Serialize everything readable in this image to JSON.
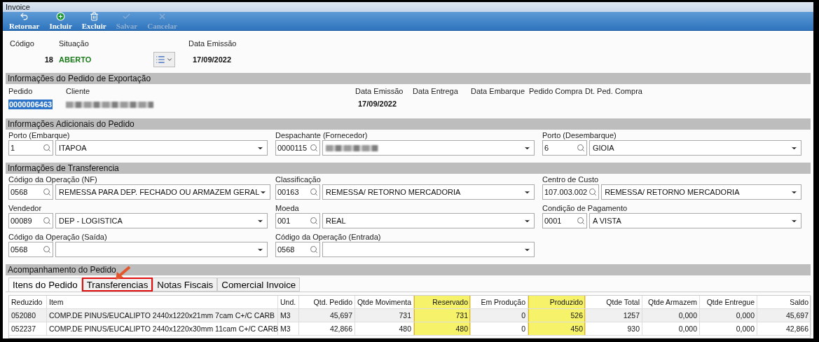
{
  "window": {
    "title": "Invoice"
  },
  "toolbar": [
    {
      "label": "Retornar",
      "disabled": false
    },
    {
      "label": "Incluir",
      "disabled": false
    },
    {
      "label": "Excluir",
      "disabled": false
    },
    {
      "label": "Salvar",
      "disabled": true
    },
    {
      "label": "Cancelar",
      "disabled": true
    }
  ],
  "header": {
    "codigo": {
      "label": "Código",
      "value": "18"
    },
    "situacao": {
      "label": "Situação",
      "value": "ABERTO"
    },
    "data_emissao": {
      "label": "Data Emissão",
      "value": "17/09/2022"
    }
  },
  "export_section": {
    "title": "Informações do Pedido de Exportação",
    "fields": [
      {
        "label": "Pedido",
        "value": "0000006463",
        "selected": true
      },
      {
        "label": "Cliente",
        "redacted": true
      }
    ],
    "dates": [
      {
        "label": "Data Emissão",
        "value": "17/09/2022"
      },
      {
        "label": "Data Entrega"
      },
      {
        "label": "Data Embarque"
      },
      {
        "label": "Pedido Compra"
      },
      {
        "label": "Dt. Ped. Compra"
      }
    ]
  },
  "sections": [
    {
      "title": "Informações Adicionais do Pedido",
      "rows": [
        [
          {
            "label": "Porto (Embarque)",
            "code": "1",
            "value": "ITAPOA"
          },
          {
            "label": "Despachante (Fornecedor)",
            "code": "0000115",
            "value_redacted": true
          },
          {
            "label": "Porto (Desembarque)",
            "code": "6",
            "value": "GIOIA"
          }
        ]
      ]
    },
    {
      "title": "Informações de Transferencia",
      "rows": [
        [
          {
            "label": "Código da Operação (NF)",
            "code": "0568",
            "value": "REMESSA PARA DEP. FECHADO OU ARMAZEM GERAL"
          },
          {
            "label": "Classificação",
            "code": "00163",
            "value": "REMESSA/ RETORNO MERCADORIA"
          },
          {
            "label": "Centro de Custo",
            "code": "107.003.002",
            "value": "REMESSA/ RETORNO MERCADORIA"
          }
        ],
        [
          {
            "label": "Vendedor",
            "code": "00089",
            "value": "DEP - LOGISTICA"
          },
          {
            "label": "Moeda",
            "code": "001",
            "value": "REAL"
          },
          {
            "label": "Condição de Pagamento",
            "code": "0001",
            "value": "A VISTA"
          }
        ],
        [
          {
            "label": "Código da Operação (Saída)",
            "code": "0568"
          },
          {
            "label": "Código da Operação (Entrada)",
            "code": "0568"
          }
        ]
      ]
    }
  ],
  "tracking": {
    "title": "Acompanhamento do Pedido",
    "tabs": [
      {
        "label": "Itens do Pedido",
        "selected": true,
        "annotated": false
      },
      {
        "label": "Transferencias",
        "selected": false,
        "annotated": true
      },
      {
        "label": "Notas Fiscais",
        "selected": false,
        "annotated": false
      },
      {
        "label": "Comercial Invoice",
        "selected": false,
        "annotated": false
      }
    ],
    "table": {
      "columns": [
        {
          "label": "Reduzido",
          "highlighted": false
        },
        {
          "label": "Item",
          "highlighted": false
        },
        {
          "label": "Und.",
          "highlighted": false
        },
        {
          "label": "Qtd. Pedido",
          "highlighted": false
        },
        {
          "label": "Qtde Movimenta",
          "highlighted": false
        },
        {
          "label": "Reservado",
          "highlighted": true
        },
        {
          "label": "Em Produção",
          "highlighted": false
        },
        {
          "label": "Produzido",
          "highlighted": true
        },
        {
          "label": "Qtde Total",
          "highlighted": false
        },
        {
          "label": "Qtde Armazem",
          "highlighted": false
        },
        {
          "label": "Qtde Entregue",
          "highlighted": false
        },
        {
          "label": "Saldo",
          "highlighted": false
        }
      ],
      "rows": [
        [
          "052080",
          "COMP.DE PINUS/EUCALIPTO 2440x1220x21mm 7cam  C+/C CARB",
          "M3",
          "45,697",
          "731",
          "731",
          "0",
          "526",
          "1257",
          "0,000",
          "0,000",
          "45,697"
        ],
        [
          "052237",
          "COMP.DE PINUS/EUCALIPTO 2440x1220x30mm 11cam  C+/C CARB",
          "M3",
          "42,866",
          "480",
          "480",
          "0",
          "450",
          "930",
          "0,000",
          "0,000",
          "42,866"
        ]
      ]
    }
  }
}
